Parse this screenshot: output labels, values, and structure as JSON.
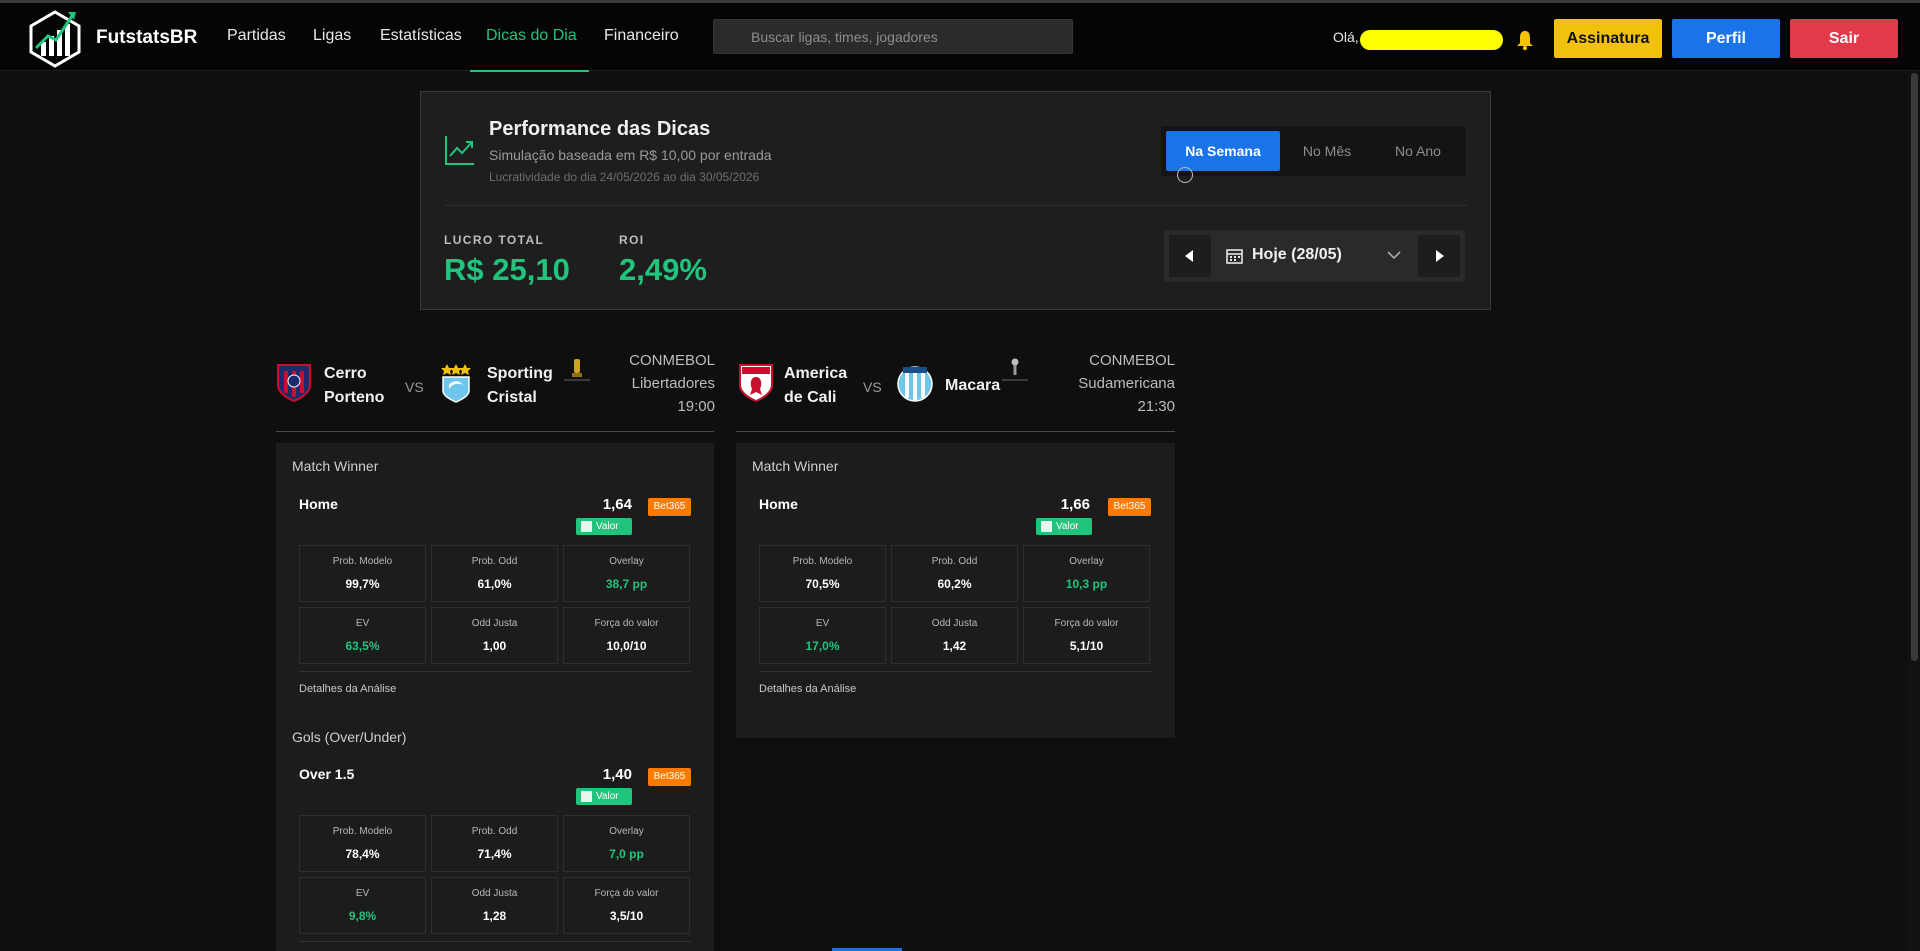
{
  "brand": "FutstatsBR",
  "nav": {
    "links": [
      "Partidas",
      "Ligas",
      "Estatísticas",
      "Dicas do Dia",
      "Financeiro"
    ],
    "active_index": 3,
    "search_placeholder": "Buscar ligas, times, jogadores",
    "greeting": "Olá,",
    "btn_assinatura": "Assinatura",
    "btn_perfil": "Perfil",
    "btn_sair": "Sair"
  },
  "colors": {
    "accent_green": "#21c47c",
    "primary_blue": "#1a73e8",
    "warning_yellow": "#f2c10d",
    "danger_red": "#e23a4a",
    "bookie_orange": "#ff7a00"
  },
  "performance": {
    "title": "Performance das Dicas",
    "subtitle": "Simulação baseada em R$ 10,00 por entrada",
    "date_range": "Lucratividade do dia 24/05/2026 ao dia 30/05/2026",
    "periods": [
      "Na Semana",
      "No Mês",
      "No Ano"
    ],
    "active_period": 0,
    "lucro_label": "LUCRO TOTAL",
    "lucro_value": "R$ 25,10",
    "roi_label": "ROI",
    "roi_value": "2,49%",
    "date_picker": "Hoje (28/05)"
  },
  "matches": [
    {
      "home": [
        "Cerro",
        "Porteno"
      ],
      "away": [
        "Sporting",
        "Cristal"
      ],
      "vs": "VS",
      "competition": [
        "CONMEBOL",
        "Libertadores"
      ],
      "time": "19:00",
      "markets": [
        {
          "market": "Match Winner",
          "pick": "Home",
          "odd": "1,64",
          "bookie": "Bet365",
          "badge": "Valor",
          "metrics": [
            {
              "label": "Prob. Modelo",
              "value": "99,7%"
            },
            {
              "label": "Prob. Odd",
              "value": "61,0%"
            },
            {
              "label": "Overlay",
              "value": "38,7 pp"
            },
            {
              "label": "EV",
              "value": "63,5%"
            },
            {
              "label": "Odd Justa",
              "value": "1,00"
            },
            {
              "label": "Força do valor",
              "value": "10,0/10"
            }
          ],
          "details": "Detalhes da Análise"
        },
        {
          "market": "Gols (Over/Under)",
          "pick": "Over 1.5",
          "odd": "1,40",
          "bookie": "Bet365",
          "badge": "Valor",
          "metrics": [
            {
              "label": "Prob. Modelo",
              "value": "78,4%"
            },
            {
              "label": "Prob. Odd",
              "value": "71,4%"
            },
            {
              "label": "Overlay",
              "value": "7,0 pp"
            },
            {
              "label": "EV",
              "value": "9,8%"
            },
            {
              "label": "Odd Justa",
              "value": "1,28"
            },
            {
              "label": "Força do valor",
              "value": "3,5/10"
            }
          ]
        }
      ]
    },
    {
      "home": [
        "America",
        "de Cali"
      ],
      "away": [
        "Macara"
      ],
      "vs": "VS",
      "competition": [
        "CONMEBOL",
        "Sudamericana"
      ],
      "time": "21:30",
      "markets": [
        {
          "market": "Match Winner",
          "pick": "Home",
          "odd": "1,66",
          "bookie": "Bet365",
          "badge": "Valor",
          "metrics": [
            {
              "label": "Prob. Modelo",
              "value": "70,5%"
            },
            {
              "label": "Prob. Odd",
              "value": "60,2%"
            },
            {
              "label": "Overlay",
              "value": "10,3 pp"
            },
            {
              "label": "EV",
              "value": "17,0%"
            },
            {
              "label": "Odd Justa",
              "value": "1,42"
            },
            {
              "label": "Força do valor",
              "value": "5,1/10"
            }
          ],
          "details": "Detalhes da Análise"
        }
      ]
    }
  ]
}
